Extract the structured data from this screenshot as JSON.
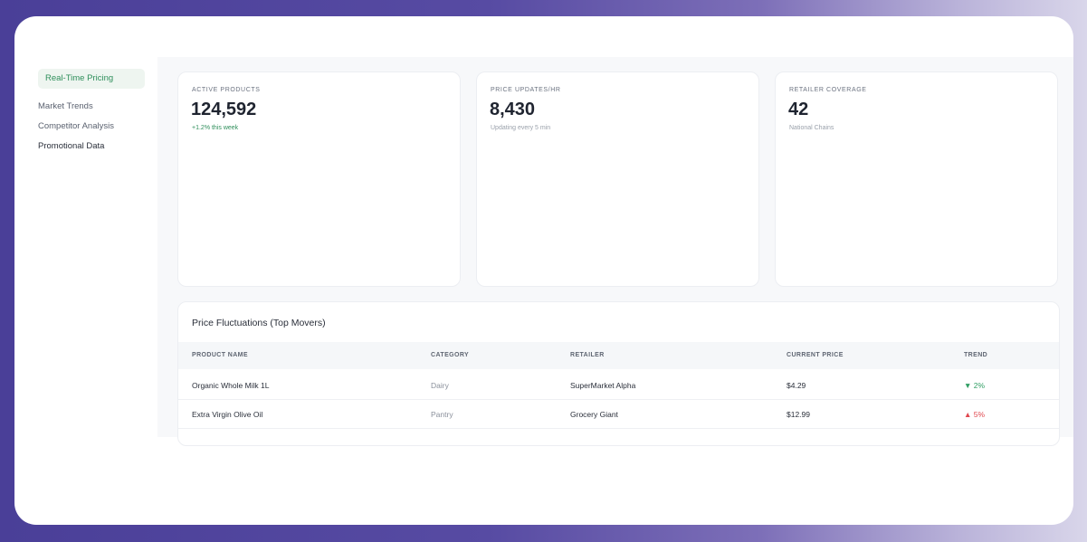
{
  "sidebar": {
    "items": [
      {
        "label": "Real-Time Pricing"
      },
      {
        "label": "Market Trends"
      },
      {
        "label": "Competitor Analysis"
      },
      {
        "label": "Promotional Data"
      }
    ]
  },
  "stats": [
    {
      "label": "ACTIVE PRODUCTS",
      "value": "124,592",
      "sub": "+1.2% this week"
    },
    {
      "label": "PRICE UPDATES/HR",
      "value": "8,430",
      "sub": "Updating every 5 min"
    },
    {
      "label": "RETAILER COVERAGE",
      "value": "42",
      "sub": "National Chains"
    }
  ],
  "table": {
    "title": "Price Fluctuations (Top Movers)",
    "columns": [
      "PRODUCT NAME",
      "CATEGORY",
      "RETAILER",
      "CURRENT PRICE",
      "TREND"
    ],
    "rows": [
      {
        "product": "Organic Whole Milk 1L",
        "category": "Dairy",
        "retailer": "SuperMarket Alpha",
        "price": "$4.29",
        "trend": "▼ 2%"
      },
      {
        "product": "Extra Virgin Olive Oil",
        "category": "Pantry",
        "retailer": "Grocery Giant",
        "price": "$12.99",
        "trend": "▲ 5%"
      }
    ]
  },
  "colors": {
    "accent_green": "#2f8f5b",
    "down": "#2f9e63",
    "up": "#e0484f"
  }
}
